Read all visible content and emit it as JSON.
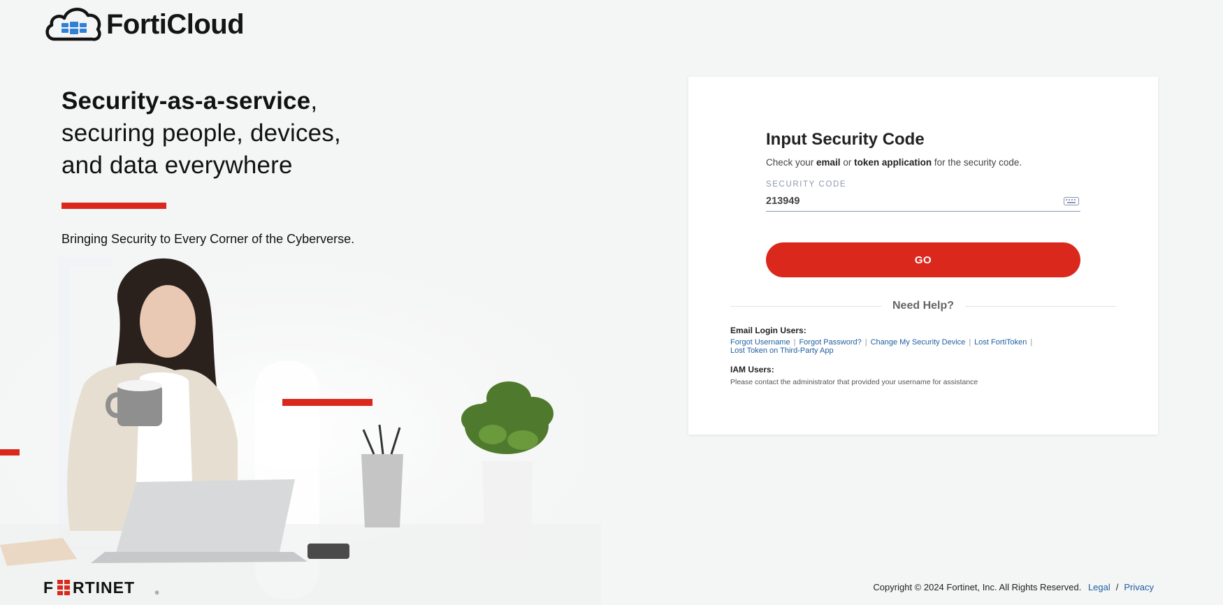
{
  "brand": {
    "name": "FortiCloud",
    "accent": "#da291c",
    "footer_logo": "F:RTINET"
  },
  "hero": {
    "title_bold": "Security-as-a-service",
    "title_comma": ",",
    "title_line2": "securing people, devices,",
    "title_line3": "and data everywhere",
    "subtitle": "Bringing Security to Every Corner of the Cyberverse."
  },
  "card": {
    "title": "Input Security Code",
    "desc_prefix": "Check your ",
    "desc_email": "email",
    "desc_or": " or ",
    "desc_token": "token application",
    "desc_suffix": " for the security code.",
    "field_label": "SECURITY CODE",
    "field_value": "213949",
    "field_icon": "keyboard-icon",
    "go_label": "GO",
    "help_label": "Need Help?",
    "email_section": "Email Login Users:",
    "links": [
      "Forgot Username",
      "Forgot Password?",
      "Change My Security Device",
      "Lost FortiToken",
      "Lost Token on Third-Party App"
    ],
    "iam_section": "IAM Users:",
    "iam_note": "Please contact the administrator that provided your username for assistance"
  },
  "footer": {
    "copyright": "Copyright © 2024 Fortinet, Inc.  All Rights Reserved.",
    "legal": "Legal",
    "slash": "/",
    "privacy": "Privacy"
  }
}
